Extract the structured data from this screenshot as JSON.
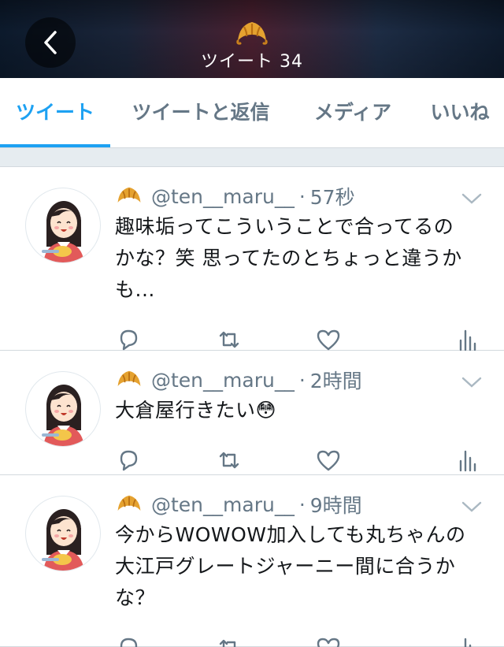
{
  "header": {
    "title": "ツイート 34",
    "back_icon": "chevron-left-icon",
    "logo_icon": "croissant-icon"
  },
  "tabs": [
    {
      "label": "ツイート",
      "active": true
    },
    {
      "label": "ツイートと返信",
      "active": false
    },
    {
      "label": "メディア",
      "active": false
    },
    {
      "label": "いいね",
      "active": false
    }
  ],
  "colors": {
    "accent": "#1da1f2",
    "muted": "#657786",
    "text": "#14171a"
  },
  "tweets": [
    {
      "handle": "@ten__maru__",
      "dot": "·",
      "time": "57秒",
      "lines": [
        "趣味垢ってこういうことで合ってるの",
        "かな？笑 思ってたのとちょっと違うか",
        "も..."
      ]
    },
    {
      "handle": "@ten__maru__",
      "dot": "·",
      "time": "2時間",
      "lines": [
        "大倉屋行きたい😳"
      ]
    },
    {
      "handle": "@ten__maru__",
      "dot": "·",
      "time": "9時間",
      "lines": [
        "今からWOWOW加入しても丸ちゃんの",
        "大江戸グレートジャーニー間に合うか",
        "な？"
      ]
    }
  ]
}
